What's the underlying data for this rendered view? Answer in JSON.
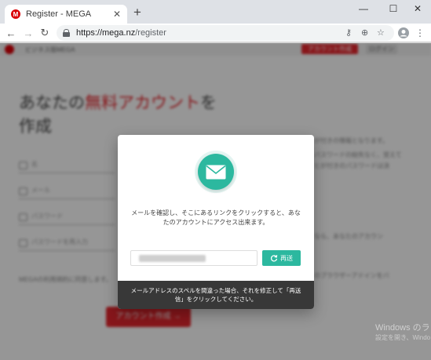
{
  "browser": {
    "tab_title": "Register - MEGA",
    "tab_close": "✕",
    "new_tab": "+",
    "url_host": "https://mega.nz",
    "url_path": "/register",
    "window_minimize": "—",
    "window_maximize": "☐",
    "window_close": "✕"
  },
  "page": {
    "nav_text": "ビジネス版MEGA",
    "top_create_button": "アカウント作成",
    "top_login_button": "ログイン",
    "headline_prefix": "あなたの",
    "headline_highlight": "無料アカウント",
    "headline_suffix": "を作成",
    "field_first_name": "名",
    "field_email": "メール",
    "field_password": "パスワード",
    "field_password_confirm": "パスワードを再入力",
    "agree_text": "MEGAの利用規約に同意します。",
    "create_button": "アカウント作成 →",
    "right_text_1": "が付きの情報となります。",
    "right_text_2": "パスワードの紛失なく、覚えて",
    "right_text_3": "ヒが付きのパスワードは決",
    "right_text_4": "なら、あなたのアカウン",
    "right_text_5": "のプラウザーアドインをバ"
  },
  "modal": {
    "message": "メールを確認し、そこにあるリンクをクリックすると、あなたのアカウントにアクセス出来ます。",
    "resend_label": "再送",
    "footer": "メールアドレスのスペルを間違った場合、それを修正して「再送信」をクリックしてください。",
    "accent_color": "#2cb89f"
  },
  "os": {
    "watermark_title": "Windows のラ",
    "watermark_sub": "設定を開き、Windo"
  }
}
